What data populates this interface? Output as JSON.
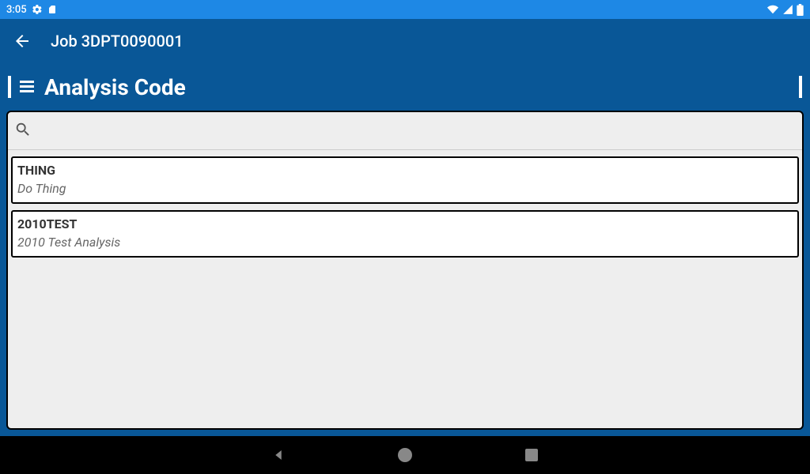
{
  "status": {
    "time": "3:05"
  },
  "appbar": {
    "title": "Job 3DPT0090001"
  },
  "section": {
    "title": "Analysis Code"
  },
  "search": {
    "placeholder": ""
  },
  "items": [
    {
      "code": "THING",
      "desc": "Do Thing"
    },
    {
      "code": "2010TEST",
      "desc": "2010 Test Analysis"
    }
  ]
}
